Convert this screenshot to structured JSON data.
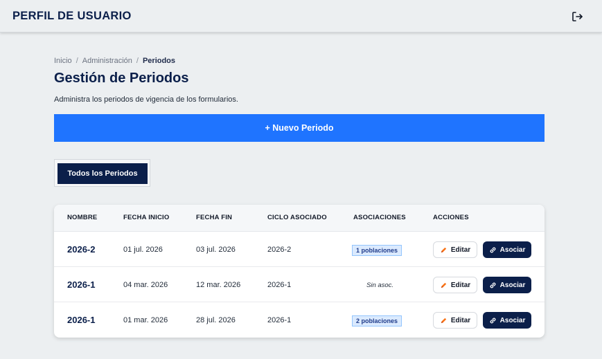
{
  "header": {
    "title": "PERFIL DE USUARIO",
    "logout_icon": "logout-icon"
  },
  "breadcrumb": {
    "items": [
      "Inicio",
      "Administración",
      "Periodos"
    ],
    "separator": "/"
  },
  "page": {
    "title": "Gestión de Periodos",
    "description": "Administra los periodos de vigencia de los formularios.",
    "new_button": "+ Nuevo Periodo",
    "filter_button": "Todos los Periodos"
  },
  "table": {
    "headers": [
      "NOMBRE",
      "FECHA INICIO",
      "FECHA FIN",
      "CICLO ASOCIADO",
      "ASOCIACIONES",
      "ACCIONES"
    ],
    "rows": [
      {
        "name": "2026-2",
        "start": "01 jul. 2026",
        "end": "03 jul. 2026",
        "cycle": "2026-2",
        "assoc": "1 poblaciones",
        "assoc_type": "badge",
        "edit": "Editar",
        "associate": "Asociar"
      },
      {
        "name": "2026-1",
        "start": "04 mar. 2026",
        "end": "12 mar. 2026",
        "cycle": "2026-1",
        "assoc": "Sin asoc.",
        "assoc_type": "text",
        "edit": "Editar",
        "associate": "Asociar"
      },
      {
        "name": "2026-1",
        "start": "01 mar. 2026",
        "end": "28 jul. 2026",
        "cycle": "2026-1",
        "assoc": "2 poblaciones",
        "assoc_type": "badge",
        "edit": "Editar",
        "associate": "Asociar"
      }
    ]
  },
  "colors": {
    "primary": "#1f74ff",
    "navy": "#0b1f4a",
    "background": "#eceff1",
    "badge_bg": "#dbeafe",
    "edit_icon": "#f97316"
  }
}
